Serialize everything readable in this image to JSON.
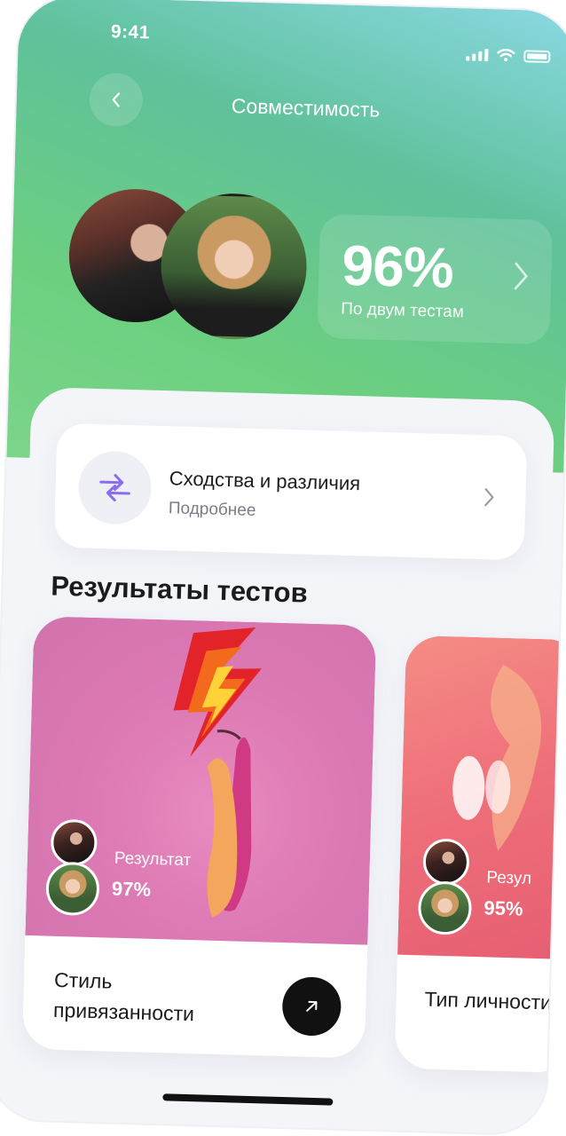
{
  "status_bar": {
    "time": "9:41"
  },
  "header": {
    "title": "Совместимость"
  },
  "score": {
    "value": "96%",
    "subtitle": "По двум тестам",
    "level": 0.96
  },
  "similarities": {
    "title": "Сходства и различия",
    "link": "Подробнее"
  },
  "section": {
    "title": "Результаты тестов"
  },
  "tests": [
    {
      "result_label": "Результат",
      "result_value": "97%",
      "name": "Стиль привязанности",
      "bg": "#dd79b4"
    },
    {
      "result_label": "Резул",
      "result_value": "95%",
      "name": "Тип личности",
      "bg": "#ee6e79"
    }
  ],
  "colors": {
    "accent": "#8b6cf0",
    "header_green": "#6ccf80",
    "header_teal": "#8ad8e2"
  }
}
